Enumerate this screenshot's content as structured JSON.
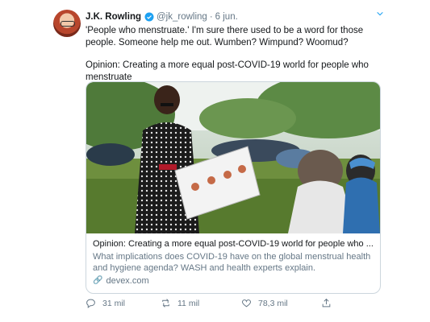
{
  "tweet": {
    "author_name": "J.K. Rowling",
    "handle": "@jk_rowling",
    "separator": "·",
    "date": "6 jun.",
    "verified_icon": "verified-badge-icon",
    "chevron_icon": "chevron-down-icon",
    "text_lines": [
      "'People who menstruate.' I'm sure there used to be a word for those people. Someone help me out. Wumben? Wimpund? Woomud?",
      "Opinion: Creating a more equal post-COVID-19 world for people who menstruate"
    ],
    "card": {
      "title": "Opinion: Creating a more equal post-COVID-19 world for people who ...",
      "description": "What implications does COVID-19 have on the global menstrual health and hygiene agenda? WASH and health experts explain.",
      "domain": "devex.com",
      "link_icon": "link-icon"
    },
    "actions": {
      "reply_count": "31 mil",
      "retweet_count": "11 mil",
      "like_count": "78,3 mil",
      "reply_icon": "reply-icon",
      "retweet_icon": "retweet-icon",
      "like_icon": "heart-icon",
      "share_icon": "share-icon"
    },
    "colors": {
      "accent": "#1da1f2",
      "secondary_text": "#657786",
      "border": "#ccd6dd"
    }
  }
}
